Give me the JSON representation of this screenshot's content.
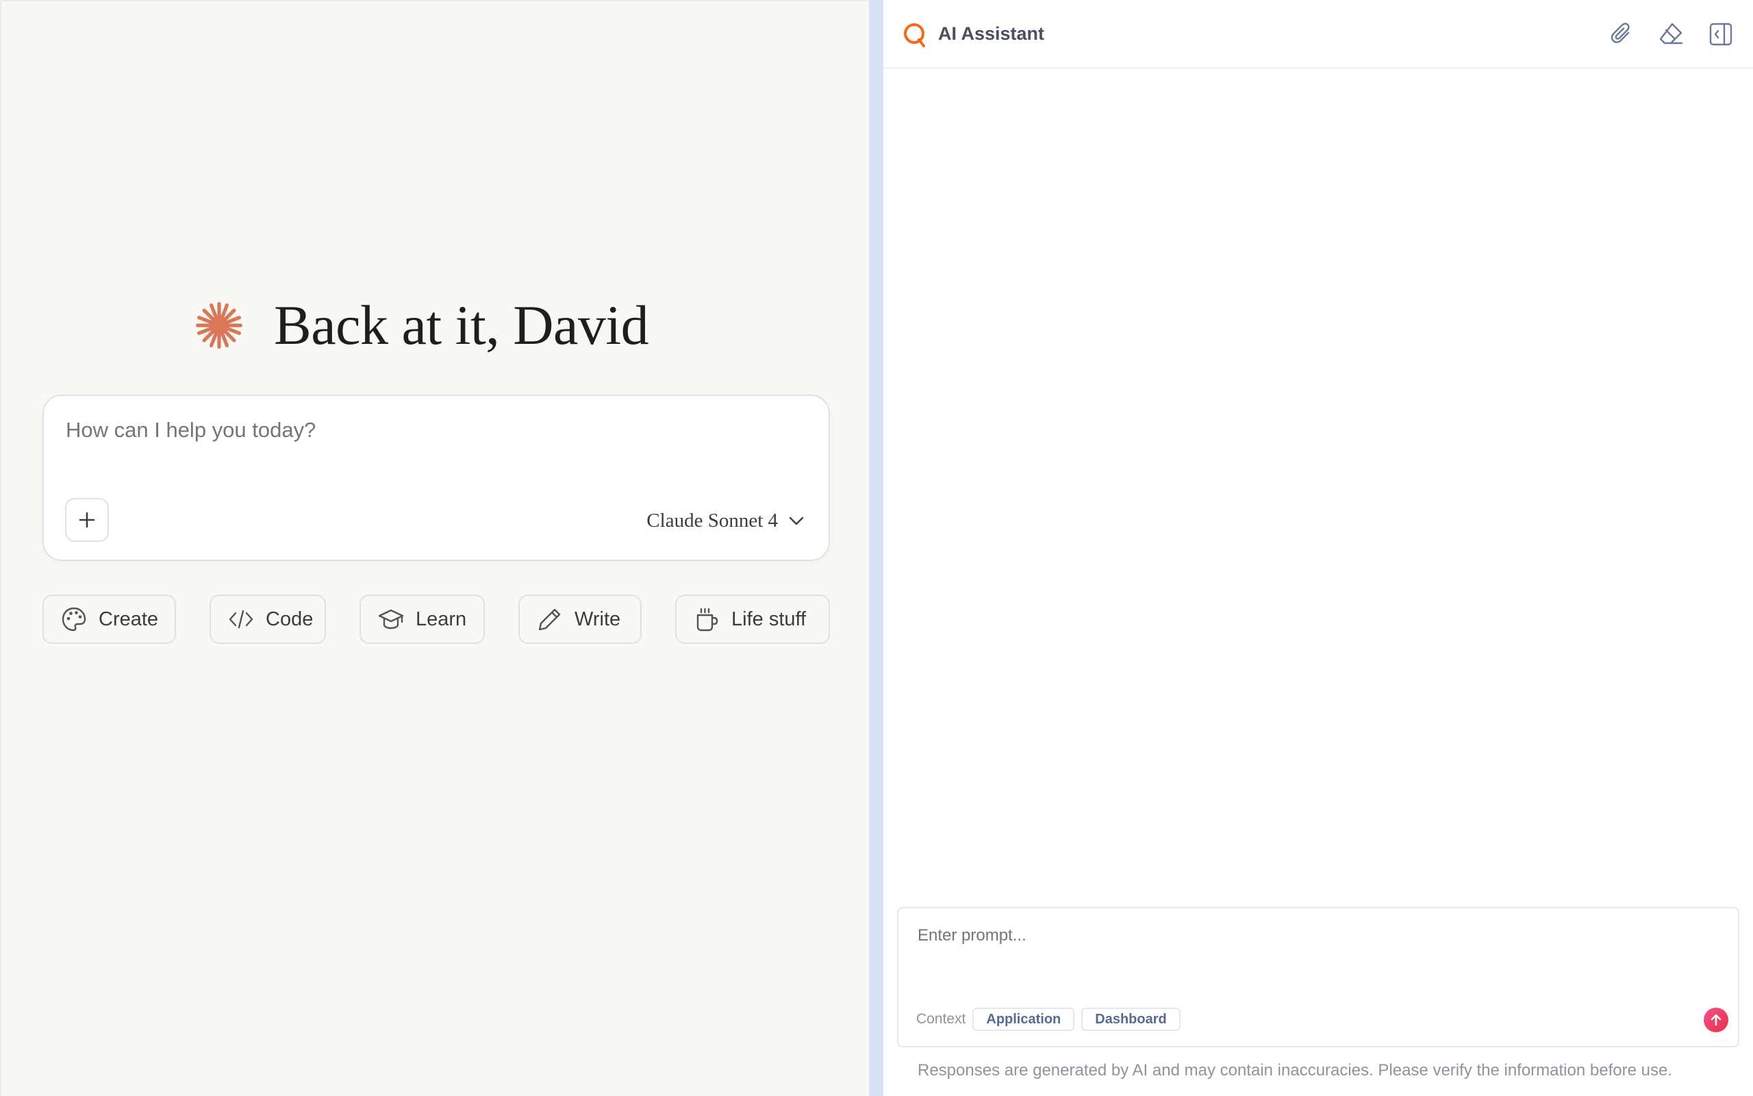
{
  "greeting": {
    "text": "Back at it, David",
    "icon": "spark-icon",
    "accent_color": "#d97757"
  },
  "composer": {
    "placeholder": "How can I help you today?",
    "add_icon": "plus-icon",
    "model": {
      "selected": "Claude Sonnet 4",
      "icon": "chevron-down-icon"
    }
  },
  "quick_actions": [
    {
      "label": "Create",
      "icon": "palette-icon"
    },
    {
      "label": "Code",
      "icon": "code-icon"
    },
    {
      "label": "Learn",
      "icon": "graduation-cap-icon"
    },
    {
      "label": "Write",
      "icon": "pencil-icon"
    },
    {
      "label": "Life stuff",
      "icon": "coffee-icon"
    }
  ],
  "assistant_panel": {
    "title": "AI Assistant",
    "logo_color": "#f36a16",
    "header_icons": [
      "paperclip-icon",
      "eraser-icon",
      "collapse-panel-icon"
    ],
    "prompt": {
      "placeholder": "Enter prompt...",
      "context_label": "Context",
      "context_chips": [
        "Application",
        "Dashboard"
      ],
      "send_icon": "arrow-up-icon"
    },
    "disclaimer": "Responses are generated by AI and may contain inaccuracies. Please verify the information before use."
  }
}
